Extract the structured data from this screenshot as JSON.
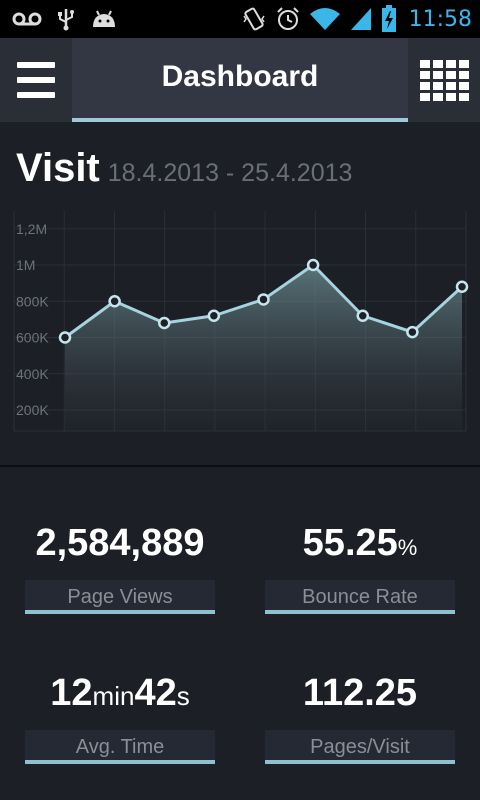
{
  "status_bar": {
    "time": "11:58",
    "icons": [
      "voicemail-icon",
      "usb-icon",
      "android-icon",
      "vibrate-icon",
      "alarm-icon",
      "wifi-icon",
      "signal-icon",
      "battery-charging-icon"
    ]
  },
  "app_bar": {
    "title": "Dashboard",
    "menu_icon": "hamburger-menu-icon",
    "grid_icon": "grid-view-icon"
  },
  "visit": {
    "title": "Visit",
    "date_range": "18.4.2013 - 25.4.2013"
  },
  "colors": {
    "accent": "#9fc9d6",
    "background": "#1c1f26",
    "clock": "#3ab7e8"
  },
  "chart_data": {
    "type": "area",
    "y_tick_labels": [
      "1,2M",
      "1M",
      "800K",
      "600K",
      "400K",
      "200K"
    ],
    "y_ticks": [
      1200000,
      1000000,
      800000,
      600000,
      400000,
      200000
    ],
    "ylim": [
      0,
      1300000
    ],
    "x": [
      1,
      2,
      3,
      4,
      5,
      6,
      7,
      8,
      9
    ],
    "values": [
      600000,
      800000,
      680000,
      720000,
      810000,
      1000000,
      720000,
      630000,
      880000
    ],
    "grid": true
  },
  "stats": {
    "page_views": {
      "value": "2,584,889",
      "label": "Page Views"
    },
    "bounce_rate": {
      "value": "55.25",
      "unit": "%",
      "label": "Bounce Rate"
    },
    "avg_time": {
      "minutes": "12",
      "min_unit": "min",
      "seconds": "42",
      "sec_unit": "s",
      "label": "Avg. Time"
    },
    "pages_visit": {
      "value": "112.25",
      "label": "Pages/Visit"
    }
  }
}
